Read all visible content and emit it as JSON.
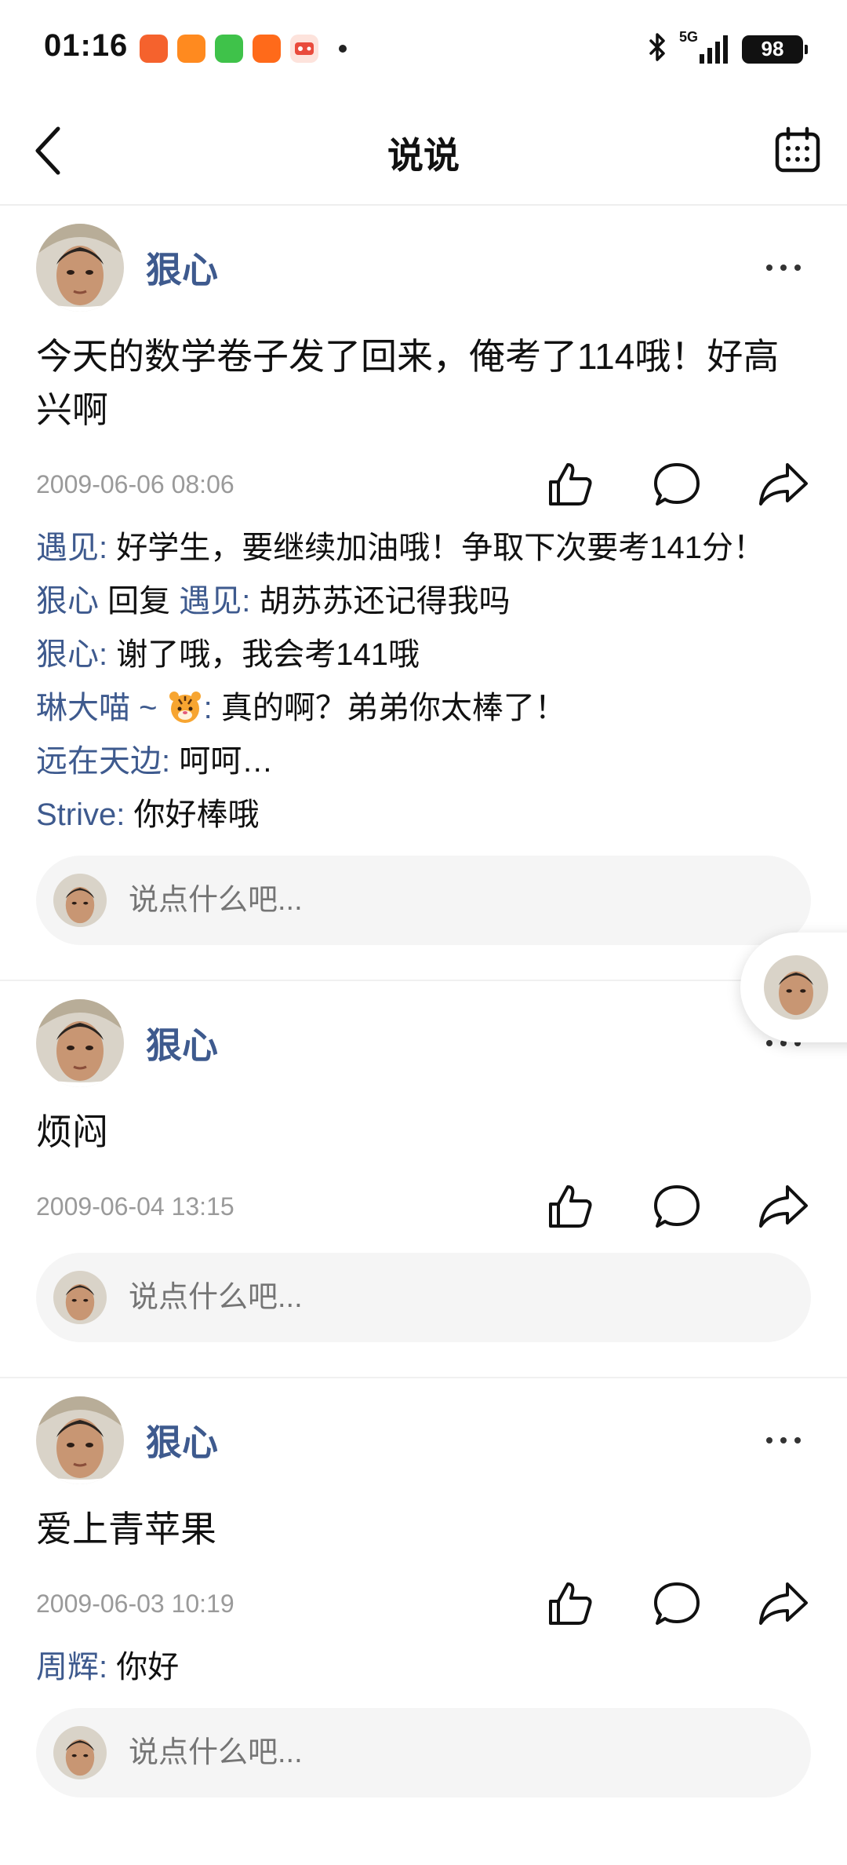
{
  "status_bar": {
    "time": "01:16",
    "network": "5G",
    "battery": "98",
    "app_icons": [
      "orange-app-icon",
      "orange-tv-icon",
      "green-chat-icon",
      "orange-person-icon",
      "red-game-icon"
    ]
  },
  "nav": {
    "title": "说说",
    "back_icon": "chevron-left-icon",
    "calendar_icon": "calendar-icon"
  },
  "colors": {
    "name_blue": "#3e5a8e",
    "time_gray": "#9a9a9a",
    "comment_box_bg": "#f5f5f5"
  },
  "posts": [
    {
      "author": "狠心",
      "content": "今天的数学卷子发了回来，俺考了114哦！好高兴啊",
      "time": "2009-06-06 08:06",
      "comments": [
        {
          "name": "遇见",
          "sep": ": ",
          "text": "好学生，要继续加油哦！争取下次要考141分！"
        },
        {
          "name": "狠心",
          "reply_word": " 回复 ",
          "reply_to": "遇见",
          "sep": ": ",
          "text": "胡苏苏还记得我吗"
        },
        {
          "name": "狠心",
          "sep": ": ",
          "text": "谢了哦，我会考141哦"
        },
        {
          "name": "琳大喵 ~ ",
          "emoji": "tiger-face-emoji",
          "sep": ": ",
          "text": "真的啊？弟弟你太棒了！"
        },
        {
          "name": "远在天边",
          "sep": ": ",
          "text": "呵呵…"
        },
        {
          "name": "Strive",
          "sep": ": ",
          "text": "你好棒哦"
        }
      ],
      "comment_placeholder": "说点什么吧..."
    },
    {
      "author": "狠心",
      "content": "烦闷",
      "time": "2009-06-04 13:15",
      "comments": [],
      "comment_placeholder": "说点什么吧..."
    },
    {
      "author": "狠心",
      "content": "爱上青苹果",
      "time": "2009-06-03 10:19",
      "comments": [
        {
          "name": "周辉",
          "sep": ": ",
          "text": "你好"
        }
      ],
      "comment_placeholder": "说点什么吧..."
    }
  ]
}
